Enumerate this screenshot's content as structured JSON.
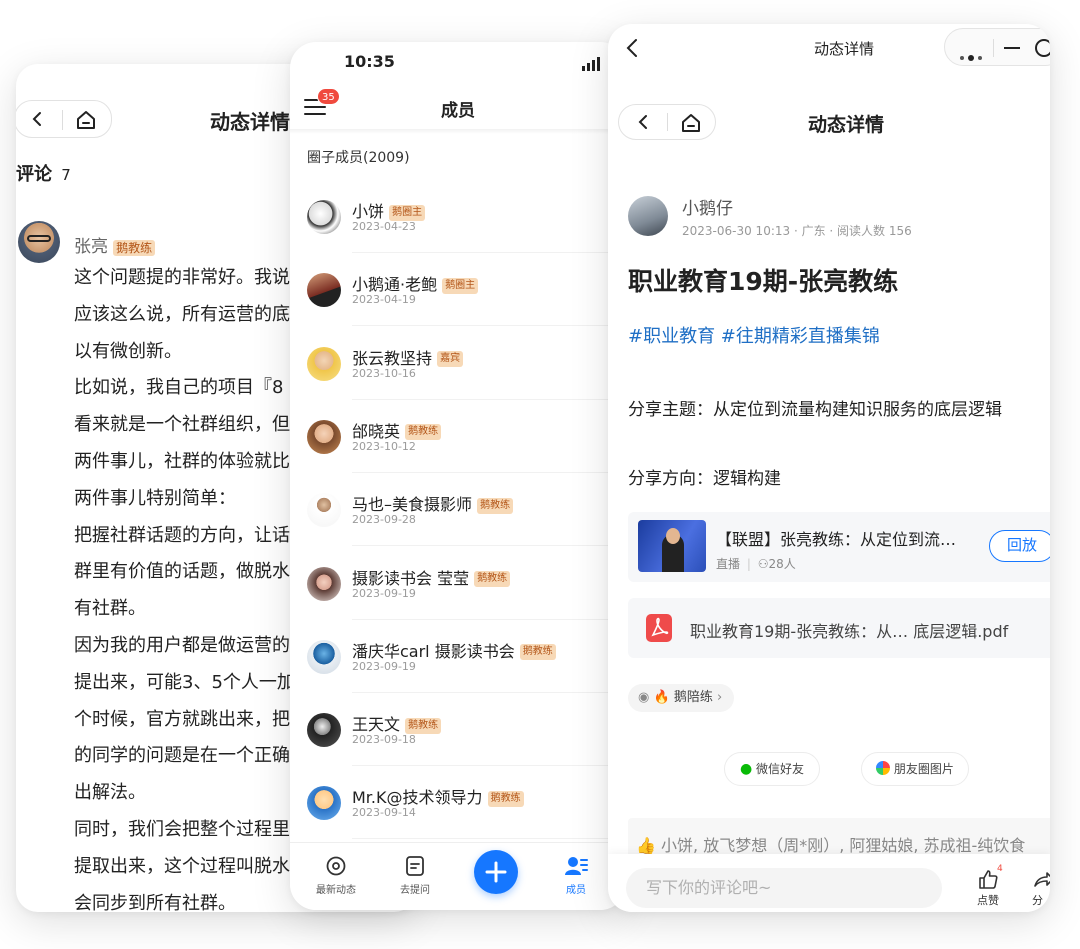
{
  "left_panel": {
    "title": "动态详情",
    "comments_label": "评论",
    "comments_count": "7",
    "commenter_name": "张亮",
    "commenter_badge": "鹅教练",
    "comment_lines": [
      "这个问题提的非常好。我说",
      "应该这么说，所有运营的底",
      "以有微创新。",
      "比如说，我自己的项目『8",
      "看来就是一个社群组织，但",
      "两件事儿，社群的体验就比",
      "两件事儿特别简单：",
      "把握社群话题的方向，让话",
      "群里有价值的话题，做脱水",
      "有社群。",
      "因为我的用户都是做运营的",
      "提出来，可能3、5个人一加",
      "个时候，官方就跳出来，把",
      "的同学的问题是在一个正确",
      "出解法。",
      "同时，我们会把整个过程里",
      "提取出来，这个过程叫脱水",
      "会同步到所有社群。"
    ]
  },
  "middle_panel": {
    "time": "10:35",
    "notification_count": "35",
    "title": "成员",
    "members_header": "圈子成员(2009)",
    "members": [
      {
        "name": "小饼",
        "badge": "鹅圈主",
        "date": "2023-04-23"
      },
      {
        "name": "小鹅通·老鲍",
        "badge": "鹅圈主",
        "date": "2023-04-19"
      },
      {
        "name": "张云教坚持",
        "badge": "嘉宾",
        "date": "2023-10-16"
      },
      {
        "name": "邰晓英",
        "badge": "鹅教练",
        "date": "2023-10-12"
      },
      {
        "name": "马也–美食摄影师",
        "badge": "鹅教练",
        "date": "2023-09-28"
      },
      {
        "name": "摄影读书会 莹莹",
        "badge": "鹅教练",
        "date": "2023-09-19"
      },
      {
        "name": "潘庆华carl 摄影读书会",
        "badge": "鹅教练",
        "date": "2023-09-19"
      },
      {
        "name": "王天文",
        "badge": "鹅教练",
        "date": "2023-09-18"
      },
      {
        "name": "Mr.K@技术领导力",
        "badge": "鹅教练",
        "date": "2023-09-14"
      }
    ],
    "tabs": {
      "latest": "最新动态",
      "ask": "去提问",
      "members": "成员"
    },
    "accent_color": "#1677ff"
  },
  "right_panel": {
    "top_title": "动态详情",
    "title": "动态详情",
    "author": "小鹅仔",
    "meta": "2023-06-30 10:13 · 广东 · 阅读人数 156",
    "post_title": "职业教育19期-张亮教练",
    "tags": "#职业教育 #往期精彩直播集锦",
    "topic_line": "分享主题：从定位到流量构建知识服务的底层逻辑",
    "direction_line": "分享方向：逻辑构建",
    "live": {
      "title": "【联盟】张亮教练：从定位到流…",
      "label": "直播",
      "viewers": "28人",
      "replay_button": "回放"
    },
    "file_name": "职业教育19期-张亮教练：从…  底层逻辑.pdf",
    "chip_label": "鹅陪练",
    "share_wechat": "微信好友",
    "share_moments": "朋友圈图片",
    "likes_text": "小饼, 放飞梦想（周*刚）, 阿狸姑娘, 苏成祖-纯饮食",
    "comment_placeholder": "写下你的评论吧~",
    "like_label": "点赞",
    "like_count": "4",
    "share_label": "分"
  }
}
